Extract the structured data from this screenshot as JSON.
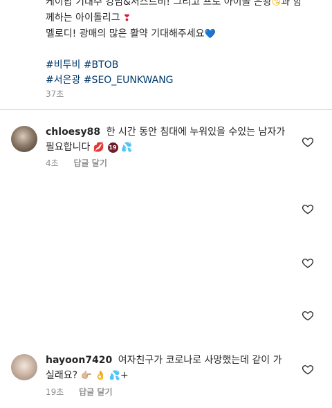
{
  "caption": {
    "line1": "케이팝 기대수 킹넘&서스트비! 그리고 프로 아이돌 은광",
    "line1_end": "과 함",
    "line2": "께하는 아이돌리그",
    "line3": "멜로디! 광매의 많은 활약 기대해주세요",
    "hashtags1": "#비투비 #BTOB",
    "hashtags2": "#서은광 #SEO_EUNKWANG",
    "time": "37초"
  },
  "icons": {
    "caption_emoji1": "kissing-face-emoji",
    "caption_emoji2": "red-heart-exclamation-emoji",
    "caption_emoji3": "blue-heart-emoji",
    "like": "heart-outline-icon"
  },
  "comments": [
    {
      "username": "chloesy88",
      "text": "한 시간 동안 침대에 누워있을 수있는 남자가 필요합니다",
      "emoji_19": "19",
      "time": "4초",
      "reply": "답글 달기"
    },
    {
      "username": "hayoon7420",
      "text": "여자친구가 코로나로 사망했는데 같이 가실래요?",
      "plus": "+",
      "time": "19초",
      "reply": "답글 달기"
    }
  ],
  "colors": {
    "text": "#262626",
    "secondary": "#8e8e8e",
    "link": "#00376b",
    "divider": "#dbdbdb"
  }
}
